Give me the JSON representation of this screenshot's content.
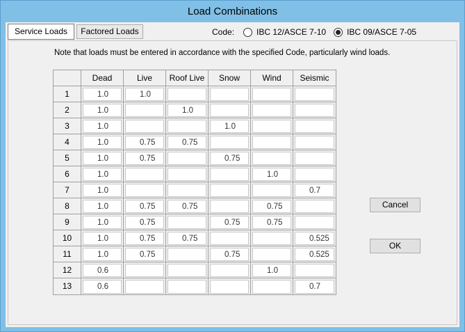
{
  "window": {
    "title": "Load Combinations"
  },
  "tabs": {
    "service": "Service Loads",
    "factored": "Factored Loads"
  },
  "code": {
    "label": "Code:",
    "option_a": "IBC 12/ASCE 7-10",
    "option_b": "IBC 09/ASCE 7-05",
    "selected": "option_b"
  },
  "note": "Note that loads must be entered in accordance with the specified Code, particularly wind loads.",
  "table": {
    "columns": [
      "Dead",
      "Live",
      "Roof Live",
      "Snow",
      "Wind",
      "Seismic"
    ],
    "rows": [
      {
        "num": "1",
        "values": [
          "1.0",
          "1.0",
          "",
          "",
          "",
          ""
        ]
      },
      {
        "num": "2",
        "values": [
          "1.0",
          "",
          "1.0",
          "",
          "",
          ""
        ]
      },
      {
        "num": "3",
        "values": [
          "1.0",
          "",
          "",
          "1.0",
          "",
          ""
        ]
      },
      {
        "num": "4",
        "values": [
          "1.0",
          "0.75",
          "0.75",
          "",
          "",
          ""
        ]
      },
      {
        "num": "5",
        "values": [
          "1.0",
          "0.75",
          "",
          "0.75",
          "",
          ""
        ]
      },
      {
        "num": "6",
        "values": [
          "1.0",
          "",
          "",
          "",
          "1.0",
          ""
        ]
      },
      {
        "num": "7",
        "values": [
          "1.0",
          "",
          "",
          "",
          "",
          "0.7"
        ]
      },
      {
        "num": "8",
        "values": [
          "1.0",
          "0.75",
          "0.75",
          "",
          "0.75",
          ""
        ]
      },
      {
        "num": "9",
        "values": [
          "1.0",
          "0.75",
          "",
          "0.75",
          "0.75",
          ""
        ]
      },
      {
        "num": "10",
        "values": [
          "1.0",
          "0.75",
          "0.75",
          "",
          "",
          "0.525"
        ]
      },
      {
        "num": "11",
        "values": [
          "1.0",
          "0.75",
          "",
          "0.75",
          "",
          "0.525"
        ]
      },
      {
        "num": "12",
        "values": [
          "0.6",
          "",
          "",
          "",
          "1.0",
          ""
        ]
      },
      {
        "num": "13",
        "values": [
          "0.6",
          "",
          "",
          "",
          "",
          "0.7"
        ]
      }
    ]
  },
  "buttons": {
    "cancel": "Cancel",
    "ok": "OK"
  }
}
